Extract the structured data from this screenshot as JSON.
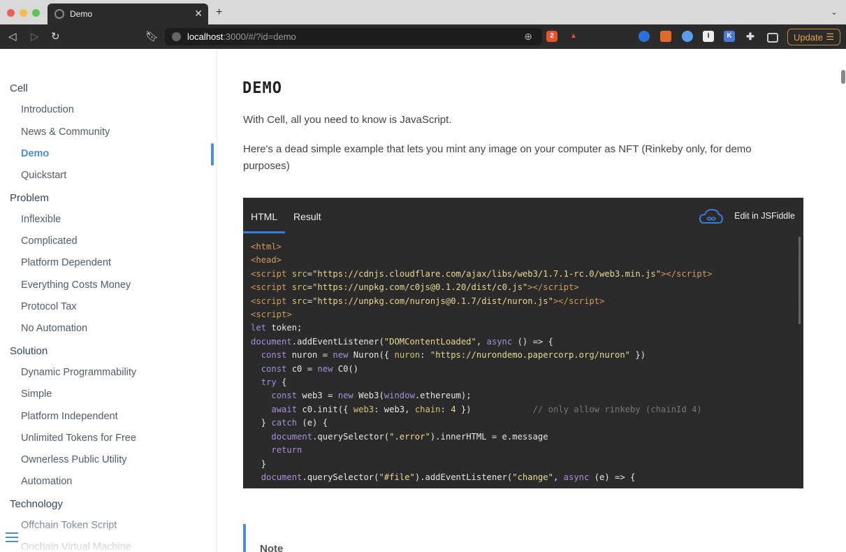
{
  "browser": {
    "tab_title": "Demo",
    "tab_close": "✕",
    "new_tab": "+",
    "url_host": "localhost",
    "url_rest": ":3000/#/?id=demo",
    "update_label": "Update",
    "brave_badge": "2"
  },
  "sidebar": {
    "sections": [
      {
        "label": "Cell",
        "items": [
          "Introduction",
          "News & Community",
          "Demo",
          "Quickstart"
        ]
      },
      {
        "label": "Problem",
        "items": [
          "Inflexible",
          "Complicated",
          "Platform Dependent",
          "Everything Costs Money",
          "Protocol Tax",
          "No Automation"
        ]
      },
      {
        "label": "Solution",
        "items": [
          "Dynamic Programmability",
          "Simple",
          "Platform Independent",
          "Unlimited Tokens for Free",
          "Ownerless Public Utility",
          "Automation"
        ]
      },
      {
        "label": "Technology",
        "items": [
          "Offchain Token Script",
          "Onchain Virtual Machine"
        ]
      }
    ],
    "active_item": "Demo"
  },
  "main": {
    "title": "DEMO",
    "intro": "With Cell, all you need to know is JavaScript.",
    "description": "Here's a dead simple example that lets you mint any image on your computer as NFT (Rinkeby only, for demo purposes)",
    "embed": {
      "tab_html": "HTML",
      "tab_result": "Result",
      "edit_label": "Edit in JSFiddle"
    },
    "note_title": "Note"
  },
  "colors": {
    "accent": "#4a8fd6",
    "code_bg": "#282828",
    "update": "#e6a33d"
  }
}
